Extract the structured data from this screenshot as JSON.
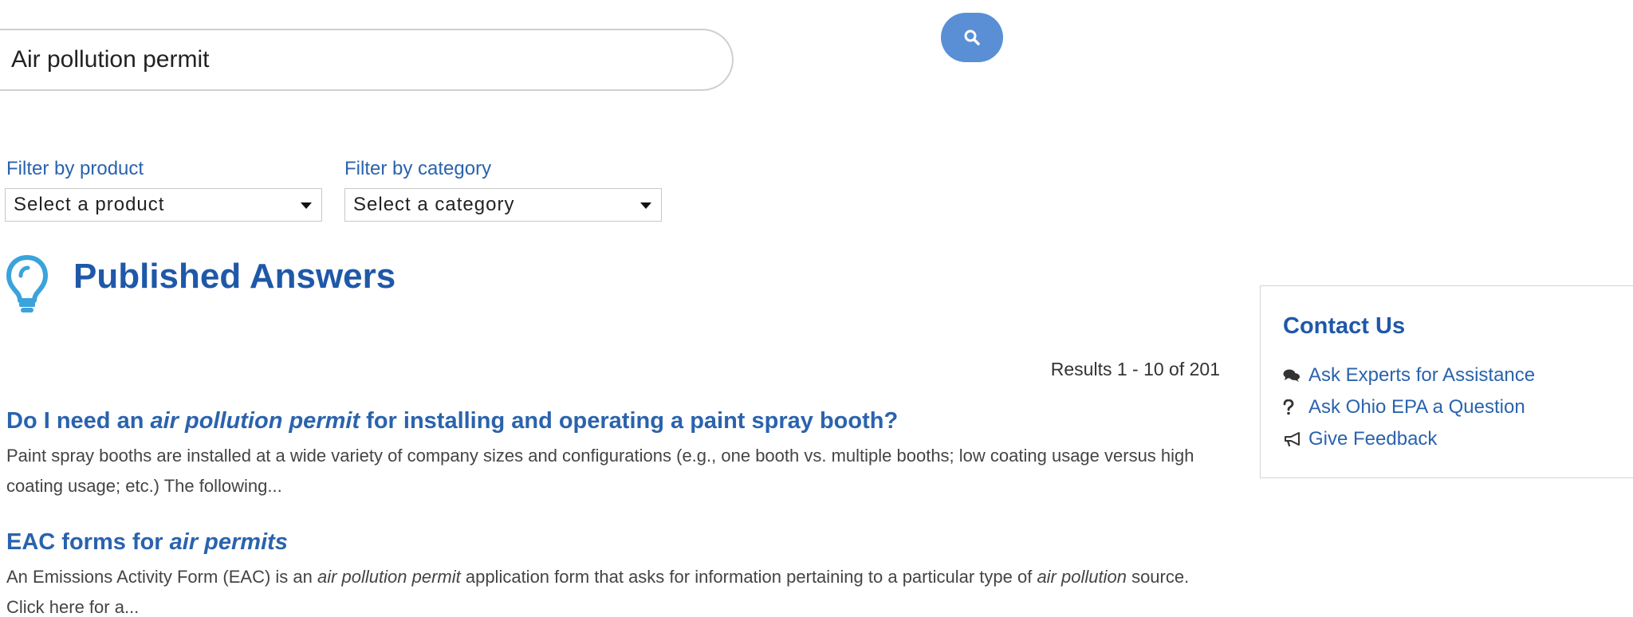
{
  "search": {
    "value": "Air pollution permit"
  },
  "filters": {
    "product": {
      "label": "Filter by product",
      "selected": "Select a product"
    },
    "category": {
      "label": "Filter by category",
      "selected": "Select a category"
    }
  },
  "heading": {
    "title": "Published Answers"
  },
  "results": {
    "count_text": "Results 1 - 10 of 201",
    "items": [
      {
        "title_parts": [
          "Do I need an ",
          "air pollution permit",
          " for installing and operating a paint spray booth?"
        ],
        "summary_parts": [
          "Paint spray booths are installed at a wide variety of company sizes and configurations (e.g., one booth vs. multiple booths; low coating usage versus high coating usage; etc.) The following..."
        ]
      },
      {
        "title_parts": [
          "EAC forms for ",
          "air permits",
          ""
        ],
        "summary_parts": [
          "An Emissions Activity Form (EAC) is an ",
          "air pollution permit",
          " application form that asks for information pertaining to a particular type of ",
          "air pollution",
          " source. Click here for a..."
        ]
      }
    ]
  },
  "contact": {
    "title": "Contact Us",
    "items": [
      {
        "icon": "chat-bubbles-icon",
        "label": "Ask Experts for Assistance"
      },
      {
        "icon": "question-mark-icon",
        "label": "Ask Ohio EPA a Question"
      },
      {
        "icon": "megaphone-icon",
        "label": "Give Feedback"
      }
    ]
  },
  "colors": {
    "link": "#2a63ad",
    "heading": "#1f58a8",
    "search_button": "#5a8fd6",
    "bulb": "#3aa3dc"
  }
}
